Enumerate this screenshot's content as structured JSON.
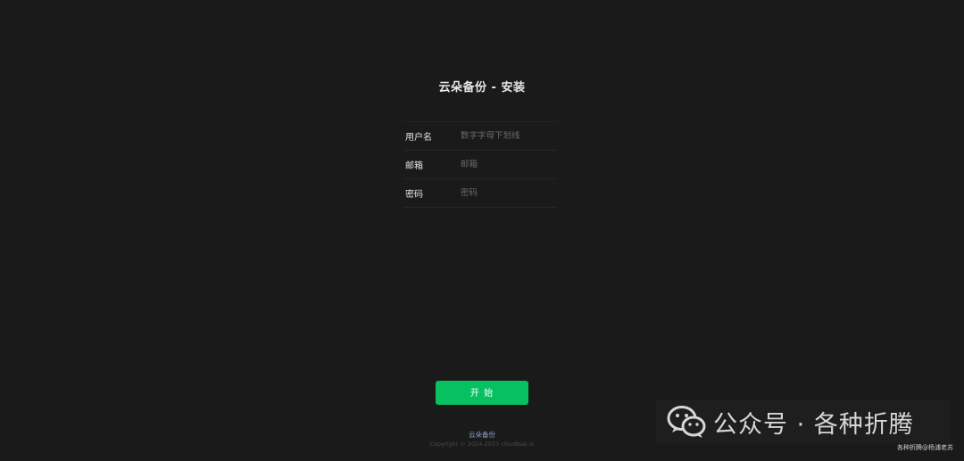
{
  "page": {
    "title": "云朵备份 - 安装"
  },
  "form": {
    "fields": [
      {
        "label": "用户名",
        "placeholder": "数字字母下划线",
        "value": ""
      },
      {
        "label": "邮箱",
        "placeholder": "邮箱",
        "value": ""
      },
      {
        "label": "密码",
        "placeholder": "密码",
        "value": ""
      }
    ],
    "submit_label": "开 始"
  },
  "footer": {
    "link_text": "云朵备份",
    "copyright": "Copyright © 2024-2025 cloudbak.io"
  },
  "watermark": {
    "text": "公众号 · 各种折腾",
    "subtext": "各种折腾@杨浦老苏",
    "icon": "wechat-icon"
  },
  "colors": {
    "background": "#1a1a1a",
    "accent": "#07c160",
    "link": "#8fa4c9"
  }
}
